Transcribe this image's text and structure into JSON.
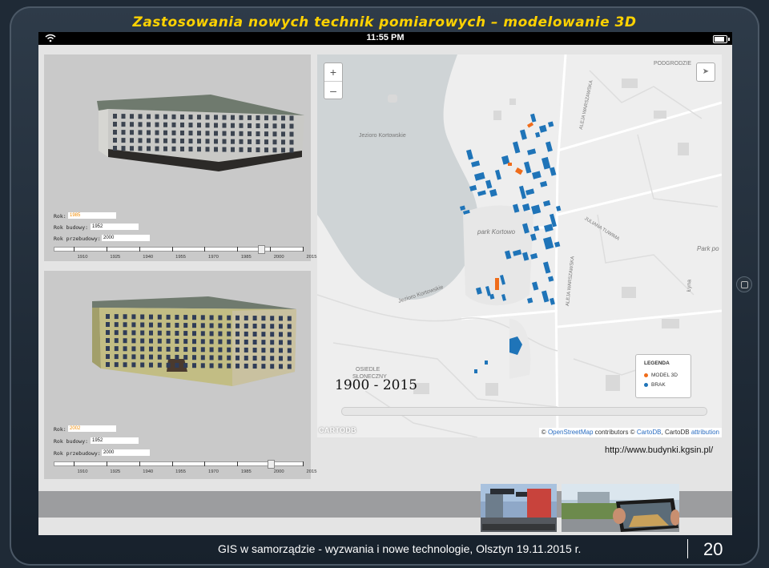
{
  "slide": {
    "title": "Zastosowania nowych technik pomiarowych – modelowanie 3D",
    "footer_text": "GIS w samorządzie - wyzwania i nowe technologie, Olsztyn 19.11.2015 r.",
    "page_number": "20",
    "title_color": "#ffd200"
  },
  "device": {
    "time": "11:55 PM",
    "wifi_icon": "wifi-icon",
    "battery_icon": "battery-icon",
    "battery_level": 0.85
  },
  "panel1": {
    "rok_label": "Rok:",
    "rok_value": "1985",
    "budowy_label": "Rok budowy:",
    "budowy_value": "1952",
    "przebudowy_label": "Rok przebudowy:",
    "przebudowy_value": "2000",
    "slider_position": 0.84
  },
  "panel2": {
    "rok_label": "Rok:",
    "rok_value": "2002",
    "budowy_label": "Rok budowy:",
    "budowy_value": "1952",
    "przebudowy_label": "Rok przebudowy:",
    "przebudowy_value": "2000",
    "slider_position": 0.88
  },
  "year_ticks": [
    "1910",
    "1925",
    "1940",
    "1955",
    "1970",
    "1985",
    "2000",
    "2015"
  ],
  "map": {
    "zoom_in": "+",
    "zoom_out": "–",
    "lake_label": "Jezioro Kortowskie",
    "lake_label2": "Jezioro Kortowskie",
    "park_label": "park Kortowo",
    "park_label2": "Park po",
    "district_label": "PODGRODZIE",
    "estate_label1": "OSIEDLE",
    "estate_label2": "SŁONECZNY",
    "street1": "ALEJA WARSZAWSKA",
    "street2": "ALEJA WARSZAWSKA",
    "street3": "JULIANA TUWIMA",
    "street4": "Łyna",
    "year_range": "1900 - 2015",
    "legend_title": "LEGENDA",
    "legend_items": [
      {
        "label": "MODEL 3D",
        "color": "#ef6c1a"
      },
      {
        "label": "BRAK",
        "color": "#1f74b8"
      }
    ],
    "brand": "CARTODB",
    "attribution_prefix": "©",
    "attribution_osm": "OpenStreetMap",
    "attribution_mid": "contributors ©",
    "attribution_carto": "CartoDB",
    "attribution_sep": ", CartoDB",
    "attribution_link": "attribution"
  },
  "url": "http://www.budynki.kgsin.pl/"
}
